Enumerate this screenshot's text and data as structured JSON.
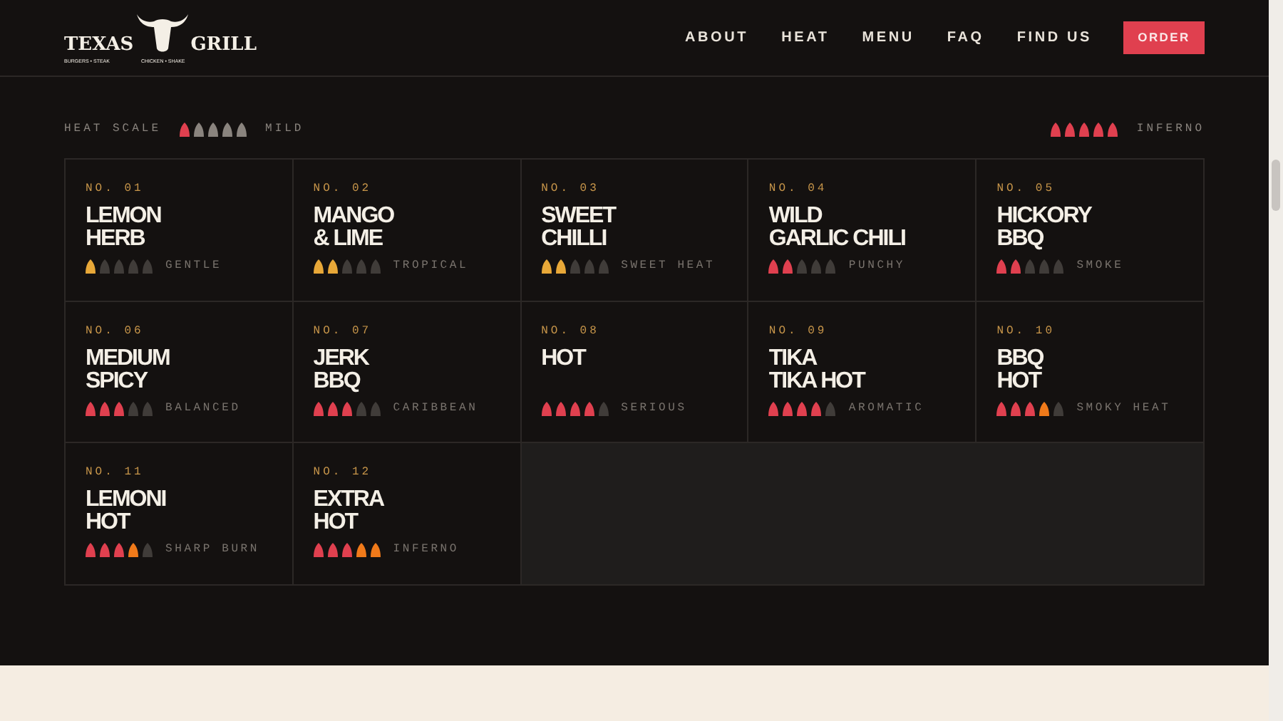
{
  "logo": {
    "left": "TEXAS",
    "right": "GRILL",
    "tagline_left": "BURGERS • STEAK",
    "tagline_right": "CHICKEN • SHAKE"
  },
  "nav": [
    "ABOUT",
    "HEAT",
    "MENU",
    "FAQ",
    "FIND US"
  ],
  "order_button": "ORDER",
  "heat_scale": {
    "label": "HEAT SCALE",
    "mild": {
      "label": "MILD",
      "peppers": [
        {
          "color": "#e0404f"
        },
        {
          "color": "#8a847e"
        },
        {
          "color": "#8a847e"
        },
        {
          "color": "#8a847e"
        },
        {
          "color": "#8a847e"
        }
      ]
    },
    "inferno": {
      "label": "INFERNO",
      "peppers": [
        {
          "color": "#e0404f"
        },
        {
          "color": "#e0404f"
        },
        {
          "color": "#e0404f"
        },
        {
          "color": "#e0404f"
        },
        {
          "color": "#e0404f"
        }
      ]
    }
  },
  "sauces": [
    {
      "number": "NO. 01",
      "name": [
        "LEMON",
        "HERB"
      ],
      "note": "GENTLE",
      "peppers": [
        {
          "color": "#e8a838"
        },
        {
          "color": "#403c39"
        },
        {
          "color": "#403c39"
        },
        {
          "color": "#403c39"
        },
        {
          "color": "#403c39"
        }
      ]
    },
    {
      "number": "NO. 02",
      "name": [
        "MANGO",
        "& LIME"
      ],
      "note": "TROPICAL",
      "peppers": [
        {
          "color": "#e8a838"
        },
        {
          "color": "#e8a838"
        },
        {
          "color": "#403c39"
        },
        {
          "color": "#403c39"
        },
        {
          "color": "#403c39"
        }
      ]
    },
    {
      "number": "NO. 03",
      "name": [
        "SWEET",
        "CHILLI"
      ],
      "note": "SWEET HEAT",
      "peppers": [
        {
          "color": "#e8a838"
        },
        {
          "color": "#e8a838"
        },
        {
          "color": "#403c39"
        },
        {
          "color": "#403c39"
        },
        {
          "color": "#403c39"
        }
      ]
    },
    {
      "number": "NO. 04",
      "name": [
        "WILD",
        "GARLIC CHILI"
      ],
      "note": "PUNCHY",
      "peppers": [
        {
          "color": "#e0404f"
        },
        {
          "color": "#e0404f"
        },
        {
          "color": "#403c39"
        },
        {
          "color": "#403c39"
        },
        {
          "color": "#403c39"
        }
      ]
    },
    {
      "number": "NO. 05",
      "name": [
        "HICKORY",
        "BBQ"
      ],
      "note": "SMOKE",
      "peppers": [
        {
          "color": "#e0404f"
        },
        {
          "color": "#e0404f"
        },
        {
          "color": "#403c39"
        },
        {
          "color": "#403c39"
        },
        {
          "color": "#403c39"
        }
      ]
    },
    {
      "number": "NO. 06",
      "name": [
        "MEDIUM",
        "SPICY"
      ],
      "note": "BALANCED",
      "peppers": [
        {
          "color": "#e0404f"
        },
        {
          "color": "#e0404f"
        },
        {
          "color": "#e0404f"
        },
        {
          "color": "#403c39"
        },
        {
          "color": "#403c39"
        }
      ]
    },
    {
      "number": "NO. 07",
      "name": [
        "JERK",
        "BBQ"
      ],
      "note": "CARIBBEAN",
      "peppers": [
        {
          "color": "#e0404f"
        },
        {
          "color": "#e0404f"
        },
        {
          "color": "#e0404f"
        },
        {
          "color": "#403c39"
        },
        {
          "color": "#403c39"
        }
      ]
    },
    {
      "number": "NO. 08",
      "name": [
        "HOT"
      ],
      "note": "SERIOUS",
      "peppers": [
        {
          "color": "#e0404f"
        },
        {
          "color": "#e0404f"
        },
        {
          "color": "#e0404f"
        },
        {
          "color": "#e0404f"
        },
        {
          "color": "#403c39"
        }
      ]
    },
    {
      "number": "NO. 09",
      "name": [
        "TIKA",
        "TIKA HOT"
      ],
      "note": "AROMATIC",
      "peppers": [
        {
          "color": "#e0404f"
        },
        {
          "color": "#e0404f"
        },
        {
          "color": "#e0404f"
        },
        {
          "color": "#e0404f"
        },
        {
          "color": "#403c39"
        }
      ]
    },
    {
      "number": "NO. 10",
      "name": [
        "BBQ",
        "HOT"
      ],
      "note": "SMOKY HEAT",
      "peppers": [
        {
          "color": "#e0404f"
        },
        {
          "color": "#e0404f"
        },
        {
          "color": "#e0404f"
        },
        {
          "color": "#f07a1a"
        },
        {
          "color": "#403c39"
        }
      ]
    },
    {
      "number": "NO. 11",
      "name": [
        "LEMONI",
        "HOT"
      ],
      "note": "SHARP BURN",
      "peppers": [
        {
          "color": "#e0404f"
        },
        {
          "color": "#e0404f"
        },
        {
          "color": "#e0404f"
        },
        {
          "color": "#f07a1a"
        },
        {
          "color": "#403c39"
        }
      ]
    },
    {
      "number": "NO. 12",
      "name": [
        "EXTRA",
        "HOT"
      ],
      "note": "INFERNO",
      "peppers": [
        {
          "color": "#e0404f"
        },
        {
          "color": "#e0404f"
        },
        {
          "color": "#e0404f"
        },
        {
          "color": "#f07a1a"
        },
        {
          "color": "#f07a1a"
        }
      ]
    }
  ]
}
